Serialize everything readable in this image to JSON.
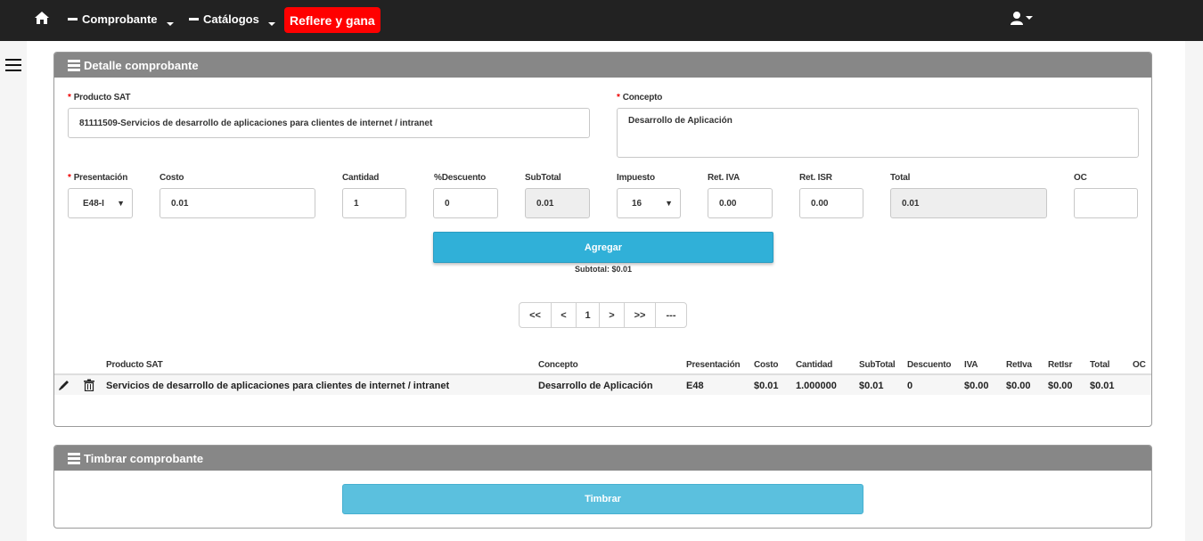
{
  "navbar": {
    "home_icon": "home-icon",
    "comprobante": "Comprobante",
    "catalogos": "Catálogos",
    "refiere": "Reflere y gana",
    "user_icon": "user-icon"
  },
  "colors": {
    "navbar_bg": "#222222",
    "brand_red": "#ff0000",
    "panel_header": "#878787",
    "primary_button": "#30b0d8",
    "timbrar_button": "#5bc0de"
  },
  "detalle": {
    "title": "Detalle comprobante",
    "producto_sat_label": "Producto SAT",
    "producto_sat_value": "81111509-Servicios de desarrollo de aplicaciones para clientes de internet / intranet",
    "concepto_label": "Concepto",
    "concepto_value": "Desarrollo de Aplicación",
    "required_mark": "*",
    "fields": {
      "presentacion_label": "Presentación",
      "presentacion_value": "E48-I",
      "costo_label": "Costo",
      "costo_value": "0.01",
      "cantidad_label": "Cantidad",
      "cantidad_value": "1",
      "descuento_label": "%Descuento",
      "descuento_value": "0",
      "subtotal_label": "SubTotal",
      "subtotal_value": "0.01",
      "impuesto_label": "Impuesto",
      "impuesto_value": "16",
      "ret_iva_label": "Ret. IVA",
      "ret_iva_value": "0.00",
      "ret_isr_label": "Ret. ISR",
      "ret_isr_value": "0.00",
      "total_label": "Total",
      "total_value": "0.01",
      "oc_label": "OC",
      "oc_value": ""
    },
    "agregar_label": "Agregar",
    "subtotal_text": "Subtotal: $0.01",
    "pager": [
      "<<",
      "<",
      "1",
      ">",
      ">>",
      "---"
    ],
    "table": {
      "headers": [
        "Producto SAT",
        "Concepto",
        "Presentación",
        "Costo",
        "Cantidad",
        "SubTotal",
        "Descuento",
        "IVA",
        "RetIva",
        "RetIsr",
        "Total",
        "OC"
      ],
      "rows": [
        {
          "producto": "Servicios de desarrollo de aplicaciones para clientes de internet / intranet",
          "concepto": "Desarrollo de Aplicación",
          "presentacion": "E48",
          "costo": "$0.01",
          "cantidad": "1.000000",
          "subtotal": "$0.01",
          "descuento": "0",
          "iva": "$0.00",
          "retiva": "$0.00",
          "retisr": "$0.00",
          "total": "$0.01",
          "oc": ""
        }
      ]
    }
  },
  "timbrar": {
    "title": "Timbrar comprobante",
    "button": "Timbrar"
  }
}
